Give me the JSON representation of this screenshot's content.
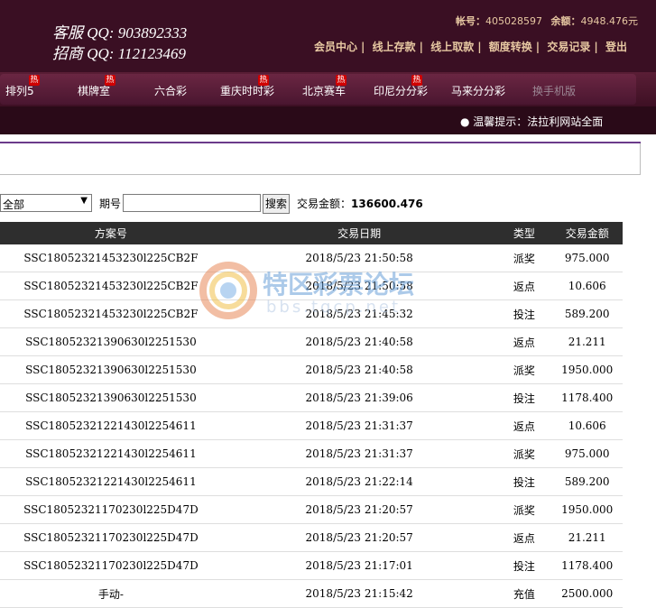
{
  "header": {
    "qq_service": "客服 QQ: 903892333",
    "qq_business": "招商 QQ: 112123469",
    "account_label": "帐号：",
    "account_value": "405028597",
    "balance_label": "余额：",
    "balance_value": "4948.476元",
    "links": [
      "会员中心",
      "线上存款",
      "线上取款",
      "额度转换",
      "交易记录",
      "登出"
    ]
  },
  "nav": {
    "hot_badge": "热",
    "items": [
      "排列5",
      "棋牌室",
      "六合彩",
      "重庆时时彩",
      "北京赛车",
      "印尼分分彩",
      "马来分分彩",
      "换手机版"
    ]
  },
  "notice": "● 温馨提示：法拉利网站全面",
  "filter": {
    "select_value": "全部",
    "period_label": "期号",
    "period_value": "",
    "search_label": "搜索",
    "amount_label": "交易金额：",
    "amount_value": "136600.476"
  },
  "table": {
    "headers": [
      "方案号",
      "交易日期",
      "类型",
      "交易金额"
    ],
    "rows": [
      [
        "SSC18052321453230l225CB2F",
        "2018/5/23 21:50:58",
        "派奖",
        "975.000"
      ],
      [
        "SSC18052321453230l225CB2F",
        "2018/5/23 21:50:58",
        "返点",
        "10.606"
      ],
      [
        "SSC18052321453230l225CB2F",
        "2018/5/23 21:45:32",
        "投注",
        "589.200"
      ],
      [
        "SSC18052321390630l2251530",
        "2018/5/23 21:40:58",
        "返点",
        "21.211"
      ],
      [
        "SSC18052321390630l2251530",
        "2018/5/23 21:40:58",
        "派奖",
        "1950.000"
      ],
      [
        "SSC18052321390630l2251530",
        "2018/5/23 21:39:06",
        "投注",
        "1178.400"
      ],
      [
        "SSC18052321221430l2254611",
        "2018/5/23 21:31:37",
        "返点",
        "10.606"
      ],
      [
        "SSC18052321221430l2254611",
        "2018/5/23 21:31:37",
        "派奖",
        "975.000"
      ],
      [
        "SSC18052321221430l2254611",
        "2018/5/23 21:22:14",
        "投注",
        "589.200"
      ],
      [
        "SSC18052321170230l225D47D",
        "2018/5/23 21:20:57",
        "派奖",
        "1950.000"
      ],
      [
        "SSC18052321170230l225D47D",
        "2018/5/23 21:20:57",
        "返点",
        "21.211"
      ],
      [
        "SSC18052321170230l225D47D",
        "2018/5/23 21:17:01",
        "投注",
        "1178.400"
      ],
      [
        "手动-",
        "2018/5/23 21:15:42",
        "充值",
        "2500.000"
      ]
    ]
  },
  "watermark": {
    "title": "特区彩票论坛",
    "sub": "bbs.tqcp.net"
  }
}
